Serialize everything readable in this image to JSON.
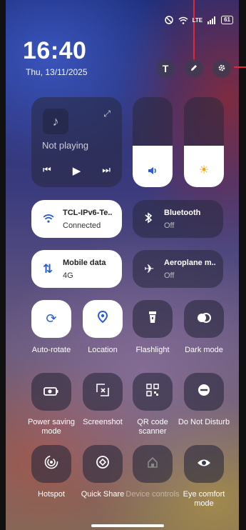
{
  "status": {
    "network": "LTE",
    "battery": "61"
  },
  "clock": {
    "time": "16:40",
    "date": "Thu, 13/11/2025"
  },
  "header_buttons": {
    "text_size": "T"
  },
  "media": {
    "status": "Not playing"
  },
  "tiles": {
    "wifi": {
      "title": "TCL-IPv6-Te..",
      "state": "Connected"
    },
    "bluetooth": {
      "title": "Bluetooth",
      "state": "Off"
    },
    "mobile_data": {
      "title": "Mobile data",
      "state": "4G"
    },
    "aeroplane": {
      "title": "Aeroplane m..",
      "state": "Off"
    }
  },
  "quick": {
    "auto_rotate": "Auto-rotate",
    "location": "Location",
    "flashlight": "Flashlight",
    "dark_mode": "Dark mode",
    "power_saving": "Power saving mode",
    "screenshot": "Screenshot",
    "qr_scanner": "QR code scanner",
    "dnd": "Do Not Disturb",
    "hotspot": "Hotspot",
    "quick_share": "Quick Share",
    "device_controls": "Device controls",
    "eye_comfort": "Eye comfort mode"
  },
  "sliders": {
    "volume_level": 0.46,
    "brightness_level": 0.46
  },
  "colors": {
    "accent": "#2a5bd7",
    "annotation": "#e0283a"
  }
}
